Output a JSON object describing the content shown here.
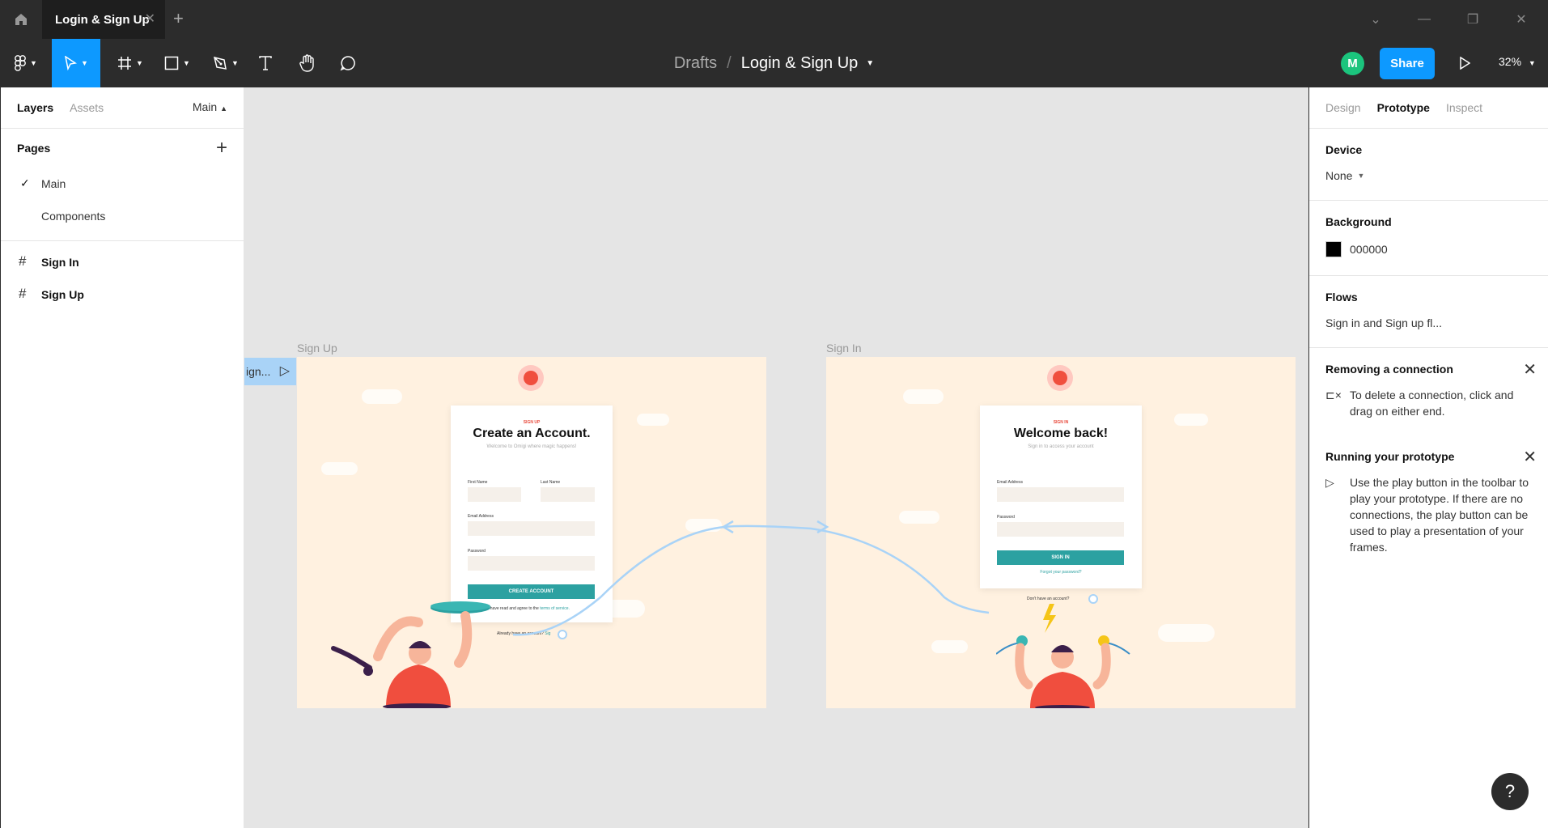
{
  "titlebar": {
    "tab_label": "Login & Sign Up"
  },
  "toolbar": {
    "breadcrumb_root": "Drafts",
    "breadcrumb_sep": "/",
    "file_name": "Login & Sign Up",
    "avatar_initial": "M",
    "share_label": "Share",
    "zoom": "32%"
  },
  "left_panel": {
    "tabs": [
      "Layers",
      "Assets"
    ],
    "current_page": "Main",
    "pages_heading": "Pages",
    "pages": [
      "Main",
      "Components"
    ],
    "layers": [
      "Sign In",
      "Sign Up"
    ]
  },
  "right_panel": {
    "tabs": [
      "Design",
      "Prototype",
      "Inspect"
    ],
    "device_heading": "Device",
    "device_value": "None",
    "background_heading": "Background",
    "background_value": "000000",
    "flows_heading": "Flows",
    "flow_name": "Sign in and Sign up fl...",
    "tip1_title": "Removing a connection",
    "tip1_body": "To delete a connection, click and drag on either end.",
    "tip2_title": "Running your prototype",
    "tip2_body": "Use the play button in the toolbar to play your prototype. If there are no connections, the play button can be used to play a presentation of your frames."
  },
  "help_label": "?",
  "canvas": {
    "flow_tag": "ign...",
    "signup_frame": {
      "label": "Sign Up",
      "eyebrow": "SIGN UP",
      "title": "Create an Account.",
      "subtitle": "Welcome to Omigi where magic happens!",
      "first_name": "First Name",
      "last_name": "Last Name",
      "email": "Email Address",
      "password": "Password",
      "button": "CREATE ACCOUNT",
      "terms_prefix": "I have read and agree to the",
      "terms_link": "terms of service.",
      "already": "Already have an account?",
      "already_link": "Sig"
    },
    "signin_frame": {
      "label": "Sign In",
      "eyebrow": "SIGN IN",
      "title": "Welcome back!",
      "subtitle": "Sign in to access your account",
      "email": "Email Address",
      "password": "Password",
      "button": "SIGN IN",
      "forgot": "Forgot your password?",
      "dont_have": "Don't have an account?"
    }
  },
  "colors": {
    "accent": "#0d99ff",
    "frame_bg": "#fff1e0",
    "teal": "#2ca1a1",
    "red": "#f04e3e",
    "connector": "#a9d3f7"
  }
}
